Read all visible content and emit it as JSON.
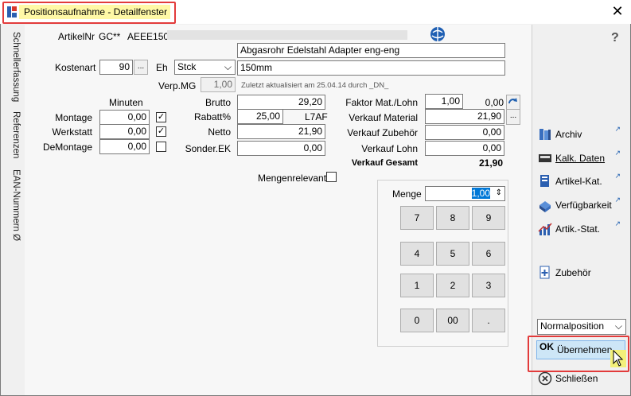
{
  "window": {
    "title": "Positionsaufnahme - Detailfenster"
  },
  "side_tabs": [
    "Schnellerfassung",
    "Referenzen",
    "EAN-Nummern Ø"
  ],
  "header": {
    "artikelnr_label": "ArtikelNr",
    "artikelnr_prefix": "GC**",
    "artikelnr_value": "AEEE150",
    "desc1": "Abgasrohr Edelstahl Adapter eng-eng",
    "desc2": "150mm",
    "kostenart_label": "Kostenart",
    "kostenart_value": "90",
    "eh_label": "Eh",
    "eh_value": "Stck",
    "verpmg_label": "Verp.MG",
    "verpmg_value": "1,00",
    "updated_note": "Zuletzt aktualisiert am 25.04.14 durch _DN_"
  },
  "minuten": {
    "header": "Minuten",
    "rows": [
      {
        "label": "Montage",
        "value": "0,00",
        "checked": true
      },
      {
        "label": "Werkstatt",
        "value": "0,00",
        "checked": true
      },
      {
        "label": "DeMontage",
        "value": "0,00",
        "checked": false
      }
    ]
  },
  "pricing": {
    "brutto_label": "Brutto",
    "brutto_value": "29,20",
    "rabatt_label": "Rabatt%",
    "rabatt_value": "25,00",
    "rabatt_code": "L7AF",
    "netto_label": "Netto",
    "netto_value": "21,90",
    "sonder_label": "Sonder.EK",
    "sonder_value": "0,00"
  },
  "verkauf": {
    "faktor_label": "Faktor Mat./Lohn",
    "faktor_value": "1,00",
    "faktor_result": "0,00",
    "material_label": "Verkauf Material",
    "material_value": "21,90",
    "zubehoer_label": "Verkauf Zubehör",
    "zubehoer_value": "0,00",
    "lohn_label": "Verkauf Lohn",
    "lohn_value": "0,00",
    "gesamt_label": "Verkauf Gesamt",
    "gesamt_value": "21,90"
  },
  "mengenrelevant_label": "Mengenrelevant",
  "menge": {
    "label": "Menge",
    "value": "1,00"
  },
  "numpad": [
    "7",
    "8",
    "9",
    "4",
    "5",
    "6",
    "1",
    "2",
    "3",
    "0",
    "00",
    "."
  ],
  "right_panel": {
    "help": "?",
    "buttons": [
      {
        "label": "Archiv",
        "icon": "archive-icon"
      },
      {
        "label": "Kalk. Daten",
        "icon": "calc-data-icon"
      },
      {
        "label": "Artikel-Kat.",
        "icon": "catalog-icon"
      },
      {
        "label": "Verfügbarkeit",
        "icon": "availability-icon"
      },
      {
        "label": "Artik.-Stat.",
        "icon": "stats-icon"
      }
    ],
    "zubehoer_label": "Zubehör",
    "position_select": "Normalposition",
    "uebernehmen_label": "Übernehmen",
    "schliessen_label": "Schließen"
  },
  "close_glyph": "✕",
  "ellipsis": "...",
  "ext_glyph": "↗"
}
